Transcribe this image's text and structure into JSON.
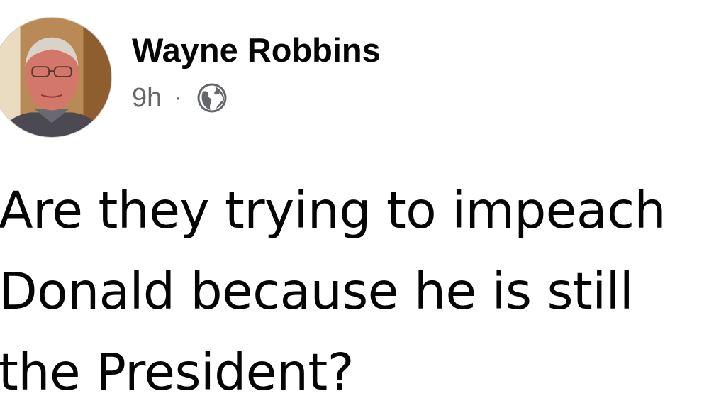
{
  "post": {
    "author": {
      "name": "Wayne Robbins",
      "avatar_icon": "profile-photo"
    },
    "meta": {
      "time": "9h",
      "separator": "·",
      "audience_icon": "globe-icon"
    },
    "text": "Are they trying to impeach\nDonald because he is still\nthe President?"
  },
  "colors": {
    "text": "#050505",
    "secondary": "#65676b",
    "background": "#ffffff"
  }
}
